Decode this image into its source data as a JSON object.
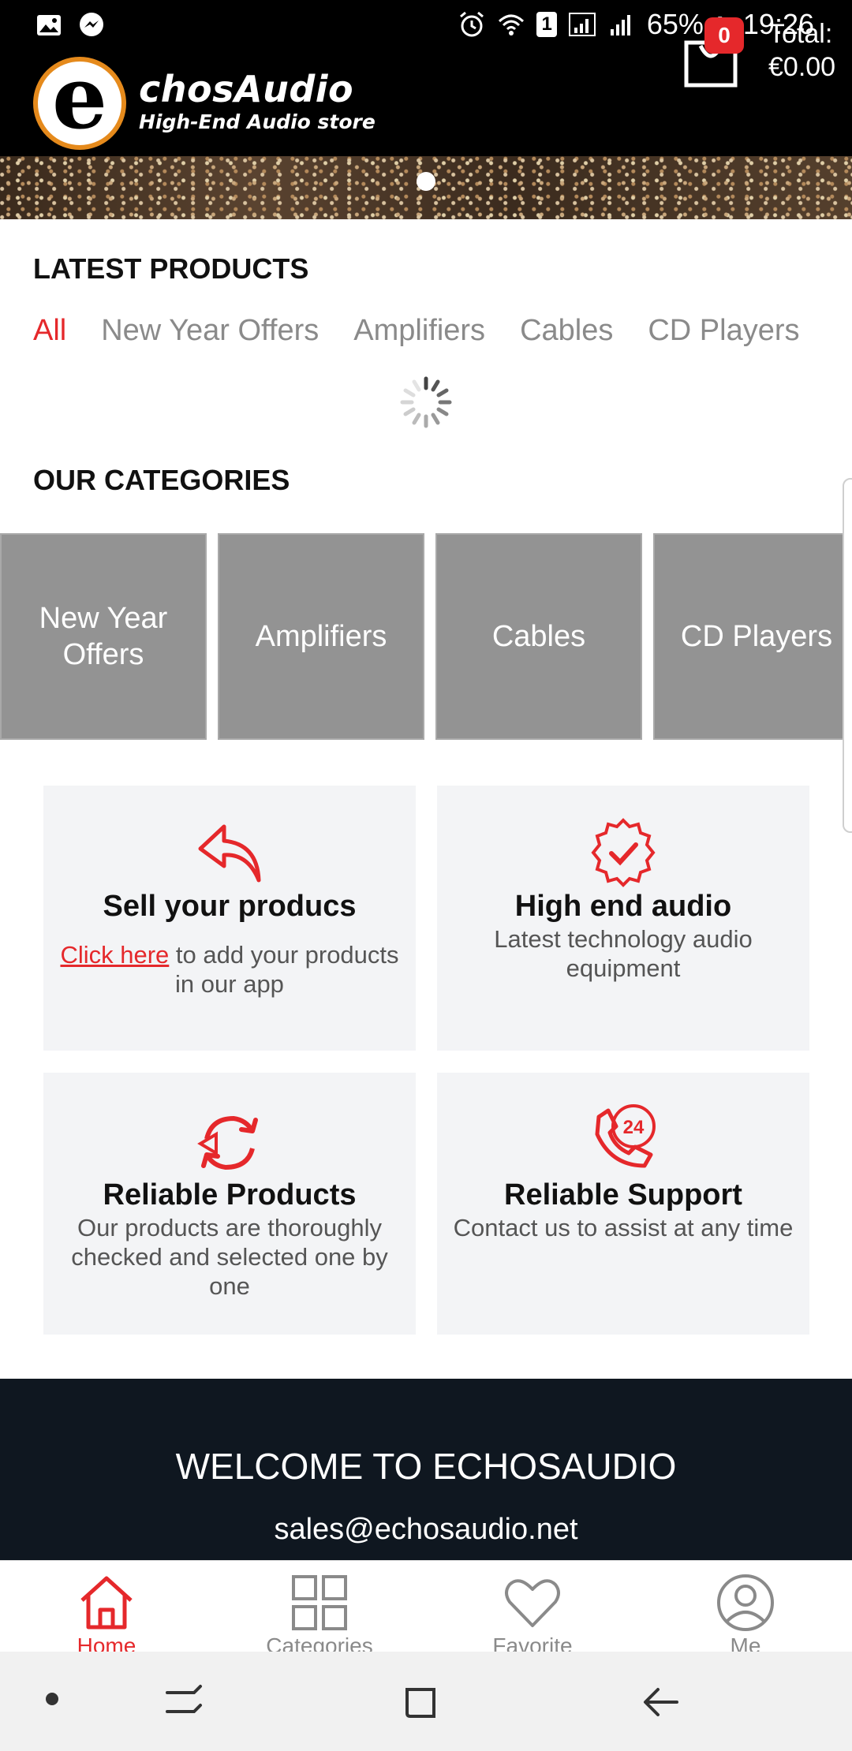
{
  "status_bar": {
    "battery": "65%",
    "time": "19:26",
    "sim_slot": "1"
  },
  "header": {
    "logo_letter": "e",
    "logo_title": "chosAudio",
    "logo_subtitle": "High-End Audio store",
    "cart_count": "0",
    "total_label": "Total:",
    "total_value": "€0.00"
  },
  "latest": {
    "title": "LATEST PRODUCTS",
    "tabs": [
      "All",
      "New Year Offers",
      "Amplifiers",
      "Cables",
      "CD Players"
    ]
  },
  "categories": {
    "title": "OUR CATEGORIES",
    "items": [
      "New Year Offers",
      "Amplifiers",
      "Cables",
      "CD Players"
    ]
  },
  "features": [
    {
      "title": "Sell your producs",
      "link": "Click here",
      "desc": " to add your products in our app",
      "icon": "reply-arrow-icon"
    },
    {
      "title": "High end audio",
      "desc": "Latest technology audio equipment",
      "icon": "verified-badge-icon"
    },
    {
      "title": "Reliable Products",
      "desc": "Our products are thoroughly checked and selected one by one",
      "icon": "refresh-cycle-icon"
    },
    {
      "title": "Reliable Support",
      "desc": "Contact us to assist at any time",
      "icon": "phone-24-icon",
      "badge": "24"
    }
  ],
  "footer": {
    "welcome": "WELCOME TO ECHOSAUDIO",
    "email": "sales@echosaudio.net"
  },
  "bottom_nav": [
    {
      "label": "Home",
      "icon": "home-icon",
      "active": true
    },
    {
      "label": "Categories",
      "icon": "grid-icon",
      "active": false
    },
    {
      "label": "Favorite",
      "icon": "heart-icon",
      "active": false
    },
    {
      "label": "Me",
      "icon": "user-icon",
      "active": false
    }
  ],
  "colors": {
    "accent": "#e5282b",
    "header_bg": "#000000",
    "footer_bg": "#0f1720",
    "card_bg": "#f3f4f6",
    "category_tile": "#939393"
  }
}
